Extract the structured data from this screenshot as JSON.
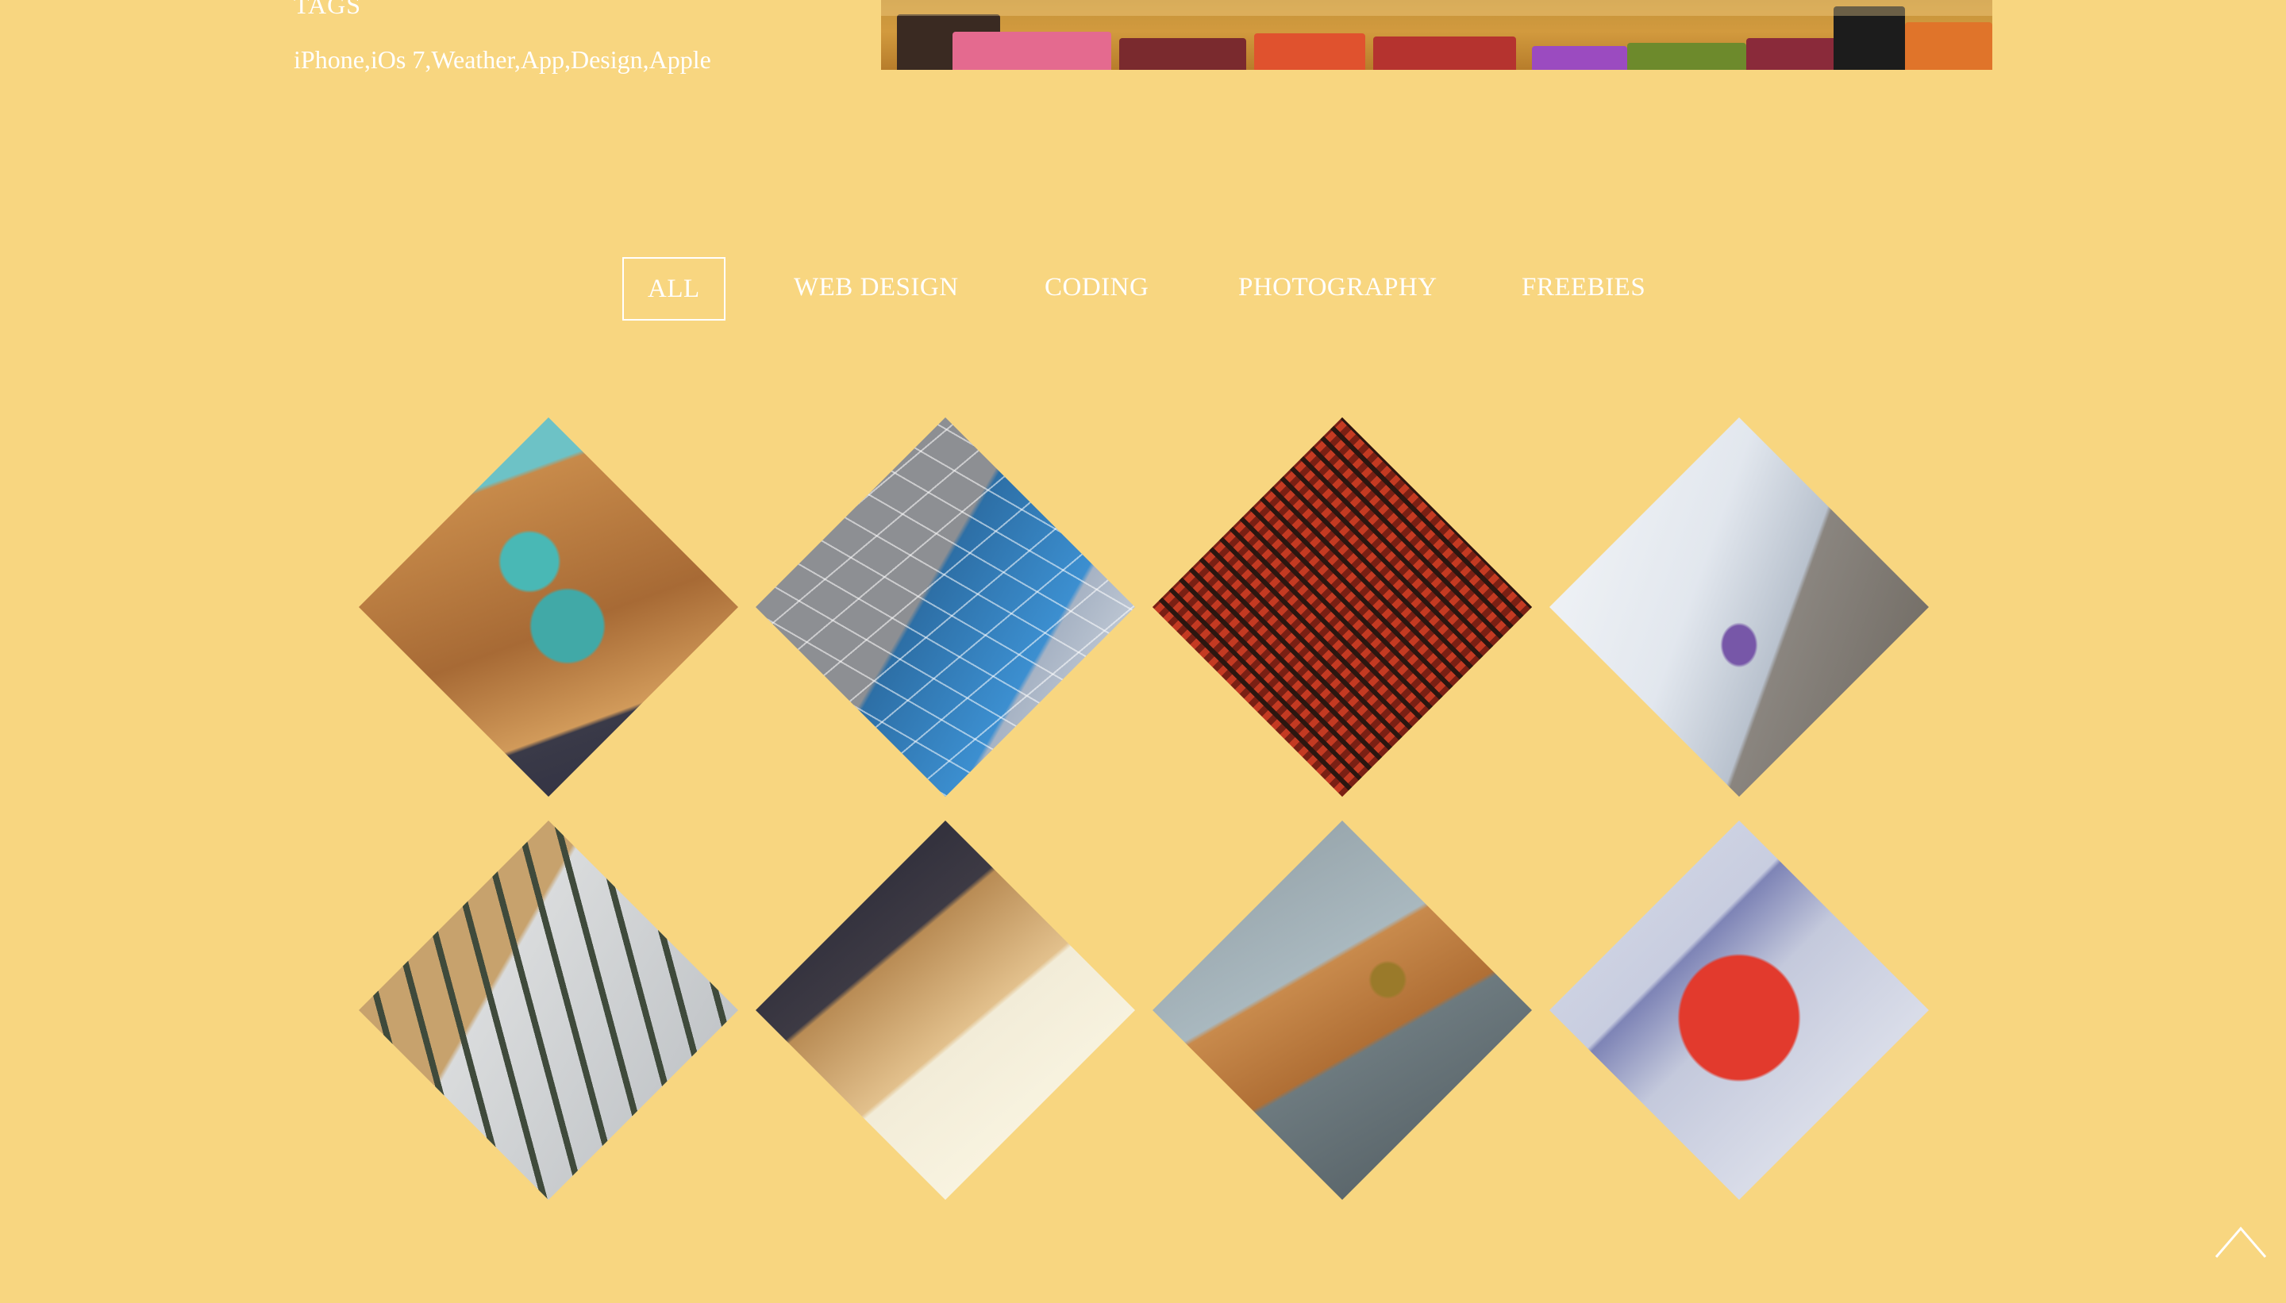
{
  "meta": {
    "label": "TAGS",
    "tags": "iPhone,iOs 7,Weather,App,Design,Apple"
  },
  "filters": [
    {
      "label": "ALL",
      "active": true
    },
    {
      "label": "WEB DESIGN",
      "active": false
    },
    {
      "label": "CODING",
      "active": false
    },
    {
      "label": "PHOTOGRAPHY",
      "active": false
    },
    {
      "label": "FREEBIES",
      "active": false
    }
  ],
  "gallery": {
    "items": [
      {
        "subject": "turquoise number five on wood"
      },
      {
        "subject": "geometric patterned pillows"
      },
      {
        "subject": "red woven strap"
      },
      {
        "subject": "white office chair and desk"
      },
      {
        "subject": "bentwood chair"
      },
      {
        "subject": "wooden letters on desk"
      },
      {
        "subject": "wooden toy airplane"
      },
      {
        "subject": "red 3d letters"
      }
    ]
  },
  "colors": {
    "background": "#f8d680",
    "text": "#ffffff"
  },
  "icons": {
    "back_to_top": "chevron-up-icon"
  }
}
